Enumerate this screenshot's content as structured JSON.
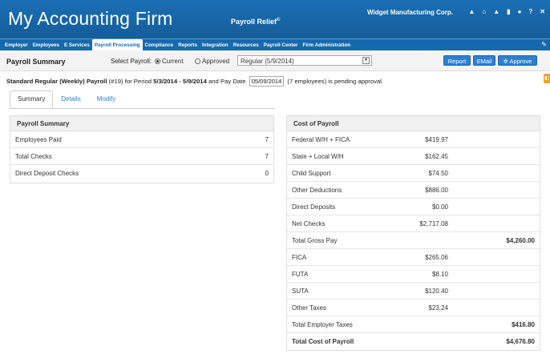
{
  "header": {
    "app_title": "My Accounting Firm",
    "product": "Payroll Relief",
    "product_mark": "©",
    "company": "Widget Manufacturing Corp.",
    "icons": [
      "user-icon",
      "home-icon",
      "bell-icon",
      "document-icon",
      "chat-icon",
      "help-icon",
      "close-icon"
    ],
    "icon_glyphs": [
      "▲",
      "⌂",
      "▲",
      "▮",
      "●",
      "?",
      "✕"
    ]
  },
  "nav": {
    "items": [
      "Employer",
      "Employees",
      "E Services",
      "Payroll Processing",
      "Compliance",
      "Reports",
      "Integration",
      "Resources",
      "Payroll Center",
      "Firm Administration"
    ],
    "active": "Payroll Processing",
    "settings_glyph": "✎"
  },
  "toolbar": {
    "page_title": "Payroll Summary",
    "select_label": "Select Payroll:",
    "radio_current": "Current",
    "radio_approved": "Approved",
    "selected_payroll": "Regular (5/9/2014)",
    "report_button": "Report",
    "email_button": "EMail",
    "approve_button": "Approve"
  },
  "info": {
    "title": "Standard Regular (Weekly) Payroll",
    "number": "(#19) for Period",
    "period": "5/3/2014 - 5/9/2014",
    "pay_date_label": "and Pay Date",
    "pay_date": "05/09/2014",
    "status": "(7 employees) is pending approval"
  },
  "tabs": [
    "Summary",
    "Details",
    "Modify"
  ],
  "payroll_summary": {
    "title": "Payroll Summary",
    "rows": [
      {
        "label": "Employees Paid",
        "value": "7"
      },
      {
        "label": "Total Checks",
        "value": "7"
      },
      {
        "label": "Direct Deposit Checks",
        "value": "0"
      }
    ]
  },
  "cost_of_payroll": {
    "title": "Cost of Payroll",
    "rows": [
      {
        "label": "Federal W/H + FICA",
        "value": "$419.97",
        "total": ""
      },
      {
        "label": "State + Local W/H",
        "value": "$162.45",
        "total": ""
      },
      {
        "label": "Child Support",
        "value": "$74.50",
        "total": ""
      },
      {
        "label": "Other Deductions",
        "value": "$886.00",
        "total": ""
      },
      {
        "label": "Direct Deposits",
        "value": "$0.00",
        "total": ""
      },
      {
        "label": "Net Checks",
        "value": "$2,717.08",
        "total": ""
      },
      {
        "label": "Total Gross Pay",
        "value": "",
        "total": "$4,260.00"
      },
      {
        "label": "FICA",
        "value": "$265.06",
        "total": ""
      },
      {
        "label": "FUTA",
        "value": "$8.10",
        "total": ""
      },
      {
        "label": "SUTA",
        "value": "$120.40",
        "total": ""
      },
      {
        "label": "Other Taxes",
        "value": "$23.24",
        "total": ""
      },
      {
        "label": "Total Employer Taxes",
        "value": "",
        "total": "$416.80"
      },
      {
        "label": "Total Cost of Payroll",
        "value": "",
        "total": "$4,676.80"
      }
    ]
  },
  "colors": {
    "header_blue": "#1769ad",
    "button_blue": "#2e7fcf",
    "side_tab_orange": "#f0a030"
  }
}
